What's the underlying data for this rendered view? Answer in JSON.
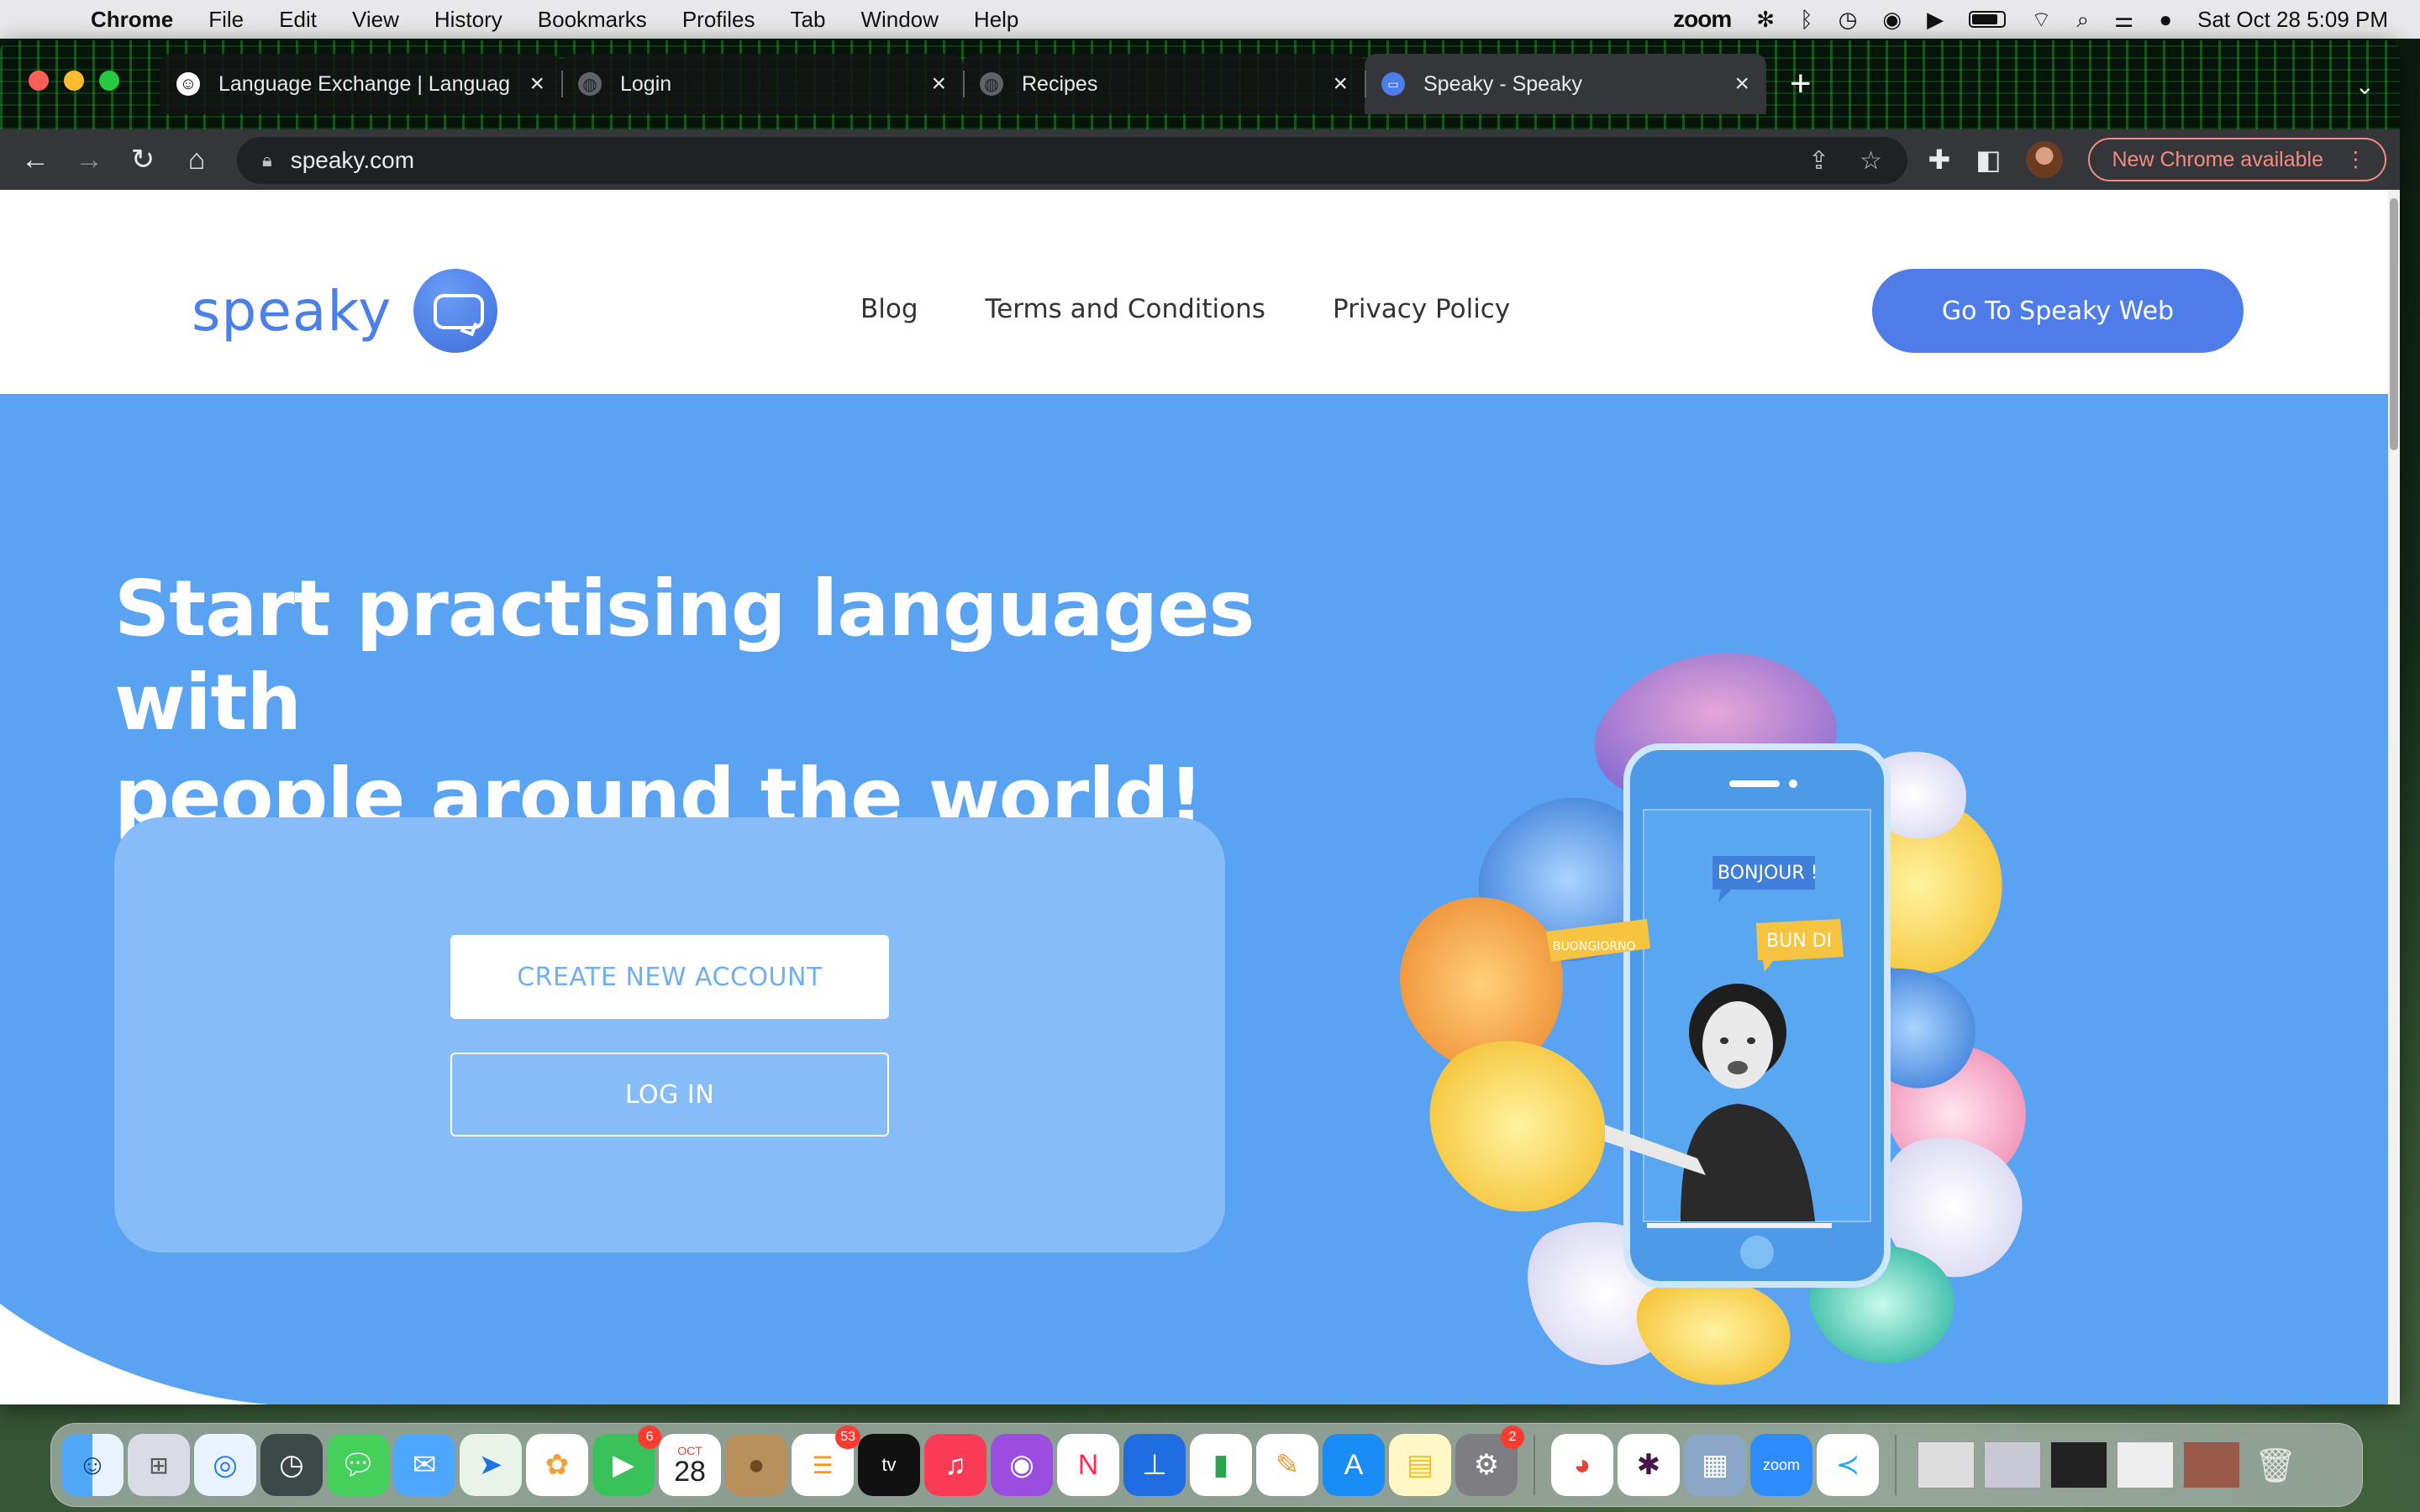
{
  "menubar": {
    "app_name": "Chrome",
    "menus": [
      "File",
      "Edit",
      "View",
      "History",
      "Bookmarks",
      "Profiles",
      "Tab",
      "Window",
      "Help"
    ],
    "zoom_label": "zoom",
    "clock": "Sat Oct 28  5:09 PM"
  },
  "browser": {
    "tabs": [
      {
        "title": "Language Exchange | Languag",
        "favicon": "smiley-icon",
        "active": false
      },
      {
        "title": "Login",
        "favicon": "globe-icon",
        "active": false
      },
      {
        "title": "Recipes",
        "favicon": "globe-icon",
        "active": false
      },
      {
        "title": "Speaky - Speaky",
        "favicon": "speaky-icon",
        "active": true
      }
    ],
    "url": "speaky.com",
    "update_chip": "New Chrome available"
  },
  "site": {
    "logo_text": "speaky",
    "nav": [
      "Blog",
      "Terms and Conditions",
      "Privacy Policy"
    ],
    "cta_web": "Go To Speaky Web"
  },
  "hero": {
    "headline_line1": "Start practising languages with",
    "headline_line2": "people around the world!",
    "create_account": "CREATE NEW ACCOUNT",
    "login": "LOG IN",
    "bubbles": [
      "BONJOUR !",
      "BUONGIORNO",
      "BUN DI"
    ]
  },
  "dock": {
    "badges": {
      "facetime": "6",
      "calendar_month": "OCT",
      "calendar_day": "28",
      "reminders": "53",
      "settings": "2"
    },
    "zoom_label": "zoom"
  },
  "colors": {
    "hero_blue": "#5aa3f2",
    "brand_blue": "#4e7dea",
    "card_blue": "#86bcf8"
  }
}
